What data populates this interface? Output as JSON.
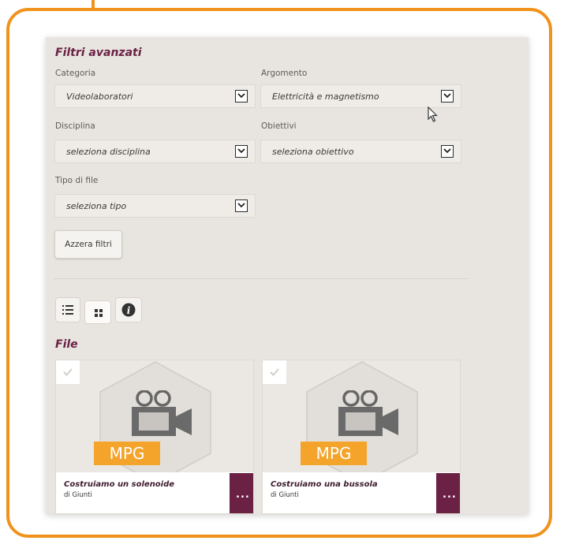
{
  "filters": {
    "title": "Filtri avanzati",
    "categoria": {
      "label": "Categoria",
      "value": "Videolaboratori"
    },
    "argomento": {
      "label": "Argomento",
      "value": "Elettricità e magnetismo"
    },
    "disciplina": {
      "label": "Disciplina",
      "value": "seleziona disciplina"
    },
    "obiettivi": {
      "label": "Obiettivi",
      "value": "seleziona obiettivo"
    },
    "tipo_file": {
      "label": "Tipo di file",
      "value": "seleziona tipo"
    },
    "reset_label": "Azzera filtri"
  },
  "view_buttons": [
    "list-view",
    "grid-view",
    "info"
  ],
  "files": {
    "title": "File",
    "items": [
      {
        "type": "MPG",
        "name": "Costruiamo un solenoide",
        "author": "di Giunti",
        "more": "..."
      },
      {
        "type": "MPG",
        "name": "Costruiamo una bussola",
        "author": "di Giunti",
        "more": "..."
      }
    ]
  },
  "colors": {
    "frame": "#f0921c",
    "accent": "#6b2144",
    "badge": "#f4a42a"
  }
}
